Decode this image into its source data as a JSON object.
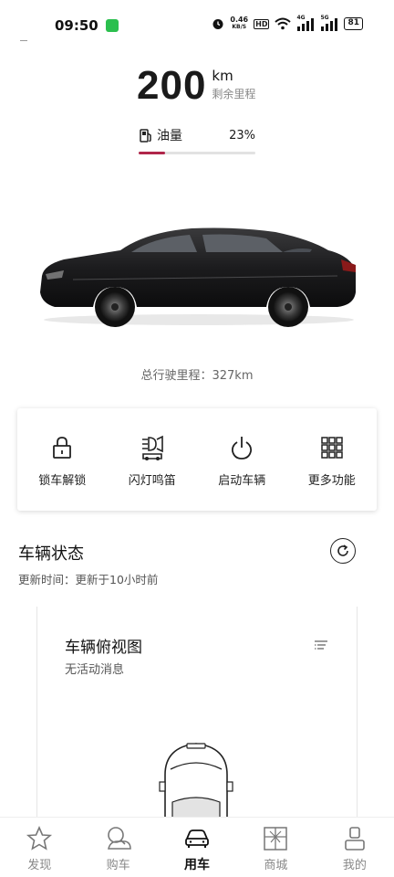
{
  "status_bar": {
    "time": "09:50",
    "net_speed_value": "0.46",
    "net_speed_unit": "KB/S",
    "hd_label": "HD",
    "battery": "81",
    "signal_4g": "4G",
    "signal_5g": "5G"
  },
  "range": {
    "value": "200",
    "unit": "km",
    "label": "剩余里程"
  },
  "fuel": {
    "label": "油量",
    "percent_text": "23%",
    "level": 0.23,
    "fill_color": "#b0264a"
  },
  "odometer": {
    "label": "总行驶里程：327km"
  },
  "quick_actions": [
    {
      "label": "锁车解锁",
      "icon": "lock-icon"
    },
    {
      "label": "闪灯鸣笛",
      "icon": "horn-lights-icon"
    },
    {
      "label": "启动车辆",
      "icon": "power-icon"
    },
    {
      "label": "更多功能",
      "icon": "grid-icon"
    }
  ],
  "vehicle_status": {
    "title": "车辆状态",
    "updated": "更新时间：更新于10小时前"
  },
  "top_view": {
    "title": "车辆俯视图",
    "subtitle": "无活动消息"
  },
  "bottom_nav": [
    {
      "label": "发现",
      "icon": "star-icon",
      "active": false
    },
    {
      "label": "购车",
      "icon": "search-car-icon",
      "active": false
    },
    {
      "label": "用车",
      "icon": "car-icon",
      "active": true
    },
    {
      "label": "商城",
      "icon": "gift-icon",
      "active": false
    },
    {
      "label": "我的",
      "icon": "user-icon",
      "active": false
    }
  ]
}
